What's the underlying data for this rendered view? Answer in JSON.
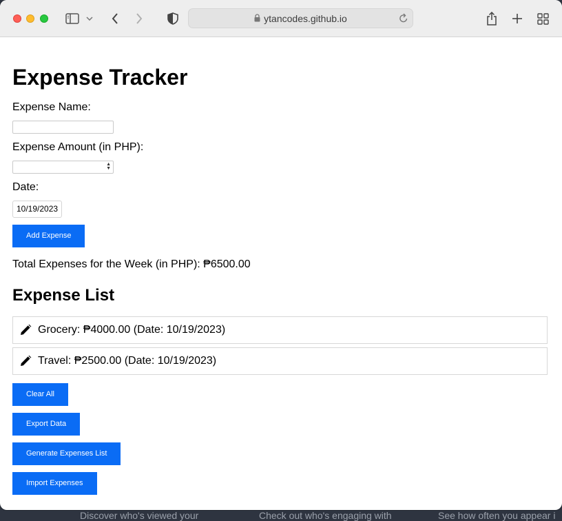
{
  "browser": {
    "url": "ytancodes.github.io"
  },
  "page": {
    "title": "Expense Tracker",
    "form": {
      "name_label": "Expense Name:",
      "name_value": "",
      "amount_label": "Expense Amount (in PHP):",
      "amount_value": "",
      "date_label": "Date:",
      "date_value": "10/19/2023",
      "add_button": "Add Expense"
    },
    "total_text": "Total Expenses for the Week (in PHP): ₱6500.00",
    "list_title": "Expense List",
    "expenses": [
      {
        "text": "Grocery: ₱4000.00 (Date: 10/19/2023)"
      },
      {
        "text": "Travel: ₱2500.00 (Date: 10/19/2023)"
      }
    ],
    "buttons": {
      "clear_all": "Clear All",
      "export": "Export Data",
      "generate": "Generate Expenses List",
      "import": "Import Expenses"
    }
  },
  "background": {
    "text1": "Discover who's viewed your",
    "text2": "Check out who's engaging with",
    "text3": "See how often you appear i"
  },
  "colors": {
    "accent": "#0a6cf5"
  }
}
